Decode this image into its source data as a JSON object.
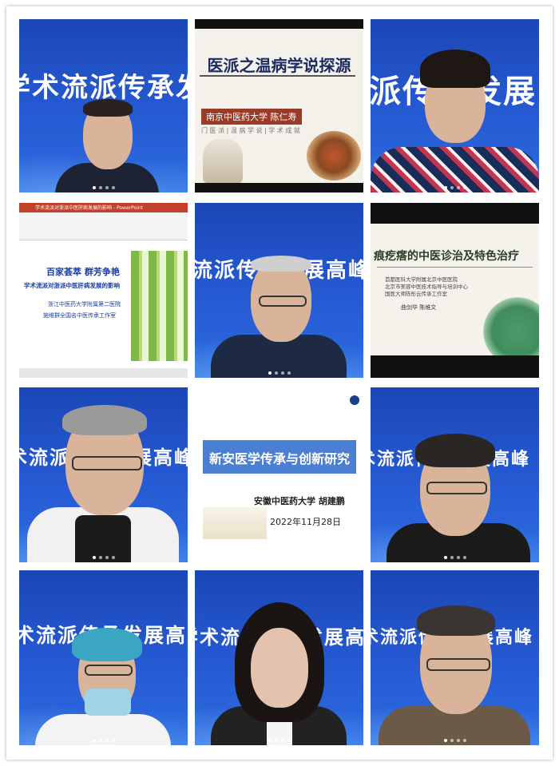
{
  "tiles": {
    "t1": {
      "banner": "学术流派传承发展高峰"
    },
    "t2": {
      "title": "医派之温病学说探源",
      "speaker": "南京中医药大学  陈仁寿",
      "tags": "门 医 派 | 温 病 学 说 | 学 术 成 就"
    },
    "t3": {
      "banner": "派传承发展"
    },
    "t4": {
      "app_title": "学术流派对浙派中医肝病发展的影响 - PowerPoint",
      "slide_line1": "百家荟萃    群芳争艳",
      "slide_line2": "学术流派对浙派中医肝病发展的影响",
      "slide_line3": "浙江中医药大学附属第二医院",
      "slide_line4": "施维群全国名中医传承工作室"
    },
    "t5": {
      "banner": "流派传承发展高峰论"
    },
    "t6": {
      "title": "痕疙瘩的中医诊治及特色治疗",
      "line1": "首都医科大学附属北京中医医院",
      "line2": "北京市美容中医技术指导与培训中心",
      "line3": "国医大师陈彤云传承工作室",
      "names": "曲剑华   陈维文"
    },
    "t7": {
      "banner": "学术流派传承发展高峰"
    },
    "t8": {
      "title": "新安医学传承与创新研究",
      "speaker": "安徽中医药大学  胡建鹏",
      "date": "2022年11月28日"
    },
    "t9": {
      "banner": "学术流派传承发展高峰"
    },
    "t10": {
      "banner": "术流派传承发展高峰论"
    },
    "t11": {
      "banner": "学术流派传承发展高峰"
    },
    "t12": {
      "banner": "学术流派传承发展高峰"
    }
  },
  "colors": {
    "banner_blue": "#2457cf",
    "title_navy": "#1c2c63",
    "slide_blue": "#4a7fd4"
  }
}
